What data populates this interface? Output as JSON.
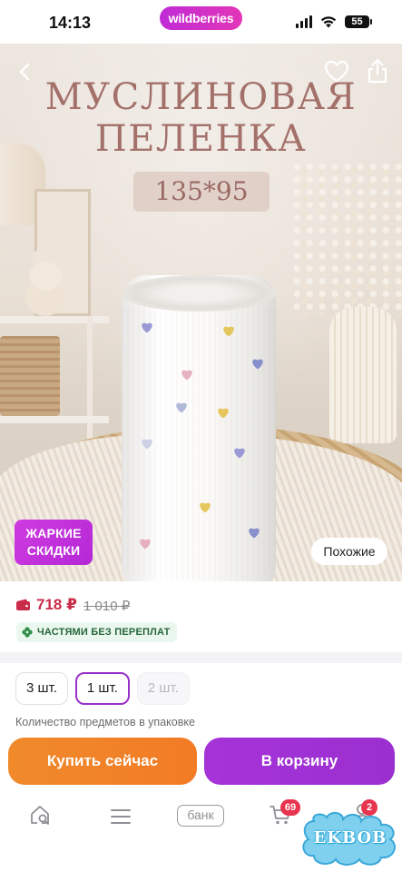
{
  "status_bar": {
    "time": "14:13",
    "brand": "wildberries",
    "battery": "55"
  },
  "hero": {
    "title_line1": "МУСЛИНОВАЯ",
    "title_line2": "ПЕЛЕНКА",
    "size": "135*95",
    "hot_deals_line1": "ЖАРКИЕ",
    "hot_deals_line2": "СКИДКИ",
    "similar": "Похожие",
    "heart_colors": [
      "#8f8fd2",
      "#e2c24a",
      "#e5a9b8",
      "#7c86c9",
      "#a9b1d4",
      "#e6c04d",
      "#c8cde2"
    ]
  },
  "price": {
    "current": "718 ₽",
    "old": "1 010 ₽",
    "installment": "ЧАСТЯМИ БЕЗ ПЕРЕПЛАТ",
    "accent": "#c92b48"
  },
  "quantity": {
    "options": [
      {
        "label": "3 шт.",
        "state": "normal"
      },
      {
        "label": "1 шт.",
        "state": "selected"
      },
      {
        "label": "2 шт.",
        "state": "disabled"
      }
    ],
    "caption": "Количество предметов в упаковке"
  },
  "actions": {
    "buy_now": "Купить сейчас",
    "to_cart": "В корзину"
  },
  "bottom_nav": {
    "items": [
      "home-search-icon",
      "catalog-icon",
      "bank-icon",
      "cart-icon",
      "profile-icon"
    ],
    "bank_label": "банк",
    "cart_count": "69",
    "profile_count": "2"
  },
  "watermark": "EKBOB"
}
